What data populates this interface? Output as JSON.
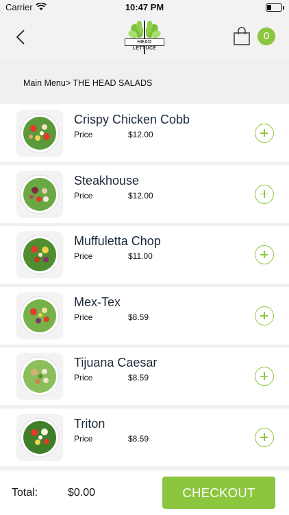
{
  "status_bar": {
    "carrier": "Carrier",
    "time": "10:47 PM"
  },
  "header": {
    "logo_text": "HEAD LETTUCE",
    "cart_count": "0"
  },
  "breadcrumb": "Main Menu> THE HEAD SALADS",
  "items": [
    {
      "name": "Crispy Chicken Cobb",
      "price_label": "Price",
      "price": "$12.00"
    },
    {
      "name": "Steakhouse",
      "price_label": "Price",
      "price": "$12.00"
    },
    {
      "name": "Muffuletta Chop",
      "price_label": "Price",
      "price": "$11.00"
    },
    {
      "name": "Mex-Tex",
      "price_label": "Price",
      "price": "$8.59"
    },
    {
      "name": "Tijuana Caesar",
      "price_label": "Price",
      "price": "$8.59"
    },
    {
      "name": "Triton",
      "price_label": "Price",
      "price": "$8.59"
    }
  ],
  "footer": {
    "total_label": "Total:",
    "total_value": "$0.00",
    "checkout_label": "CHECKOUT"
  },
  "colors": {
    "accent": "#8cc63f",
    "background": "#f0f0f0",
    "item_name": "#1c2a3a"
  }
}
